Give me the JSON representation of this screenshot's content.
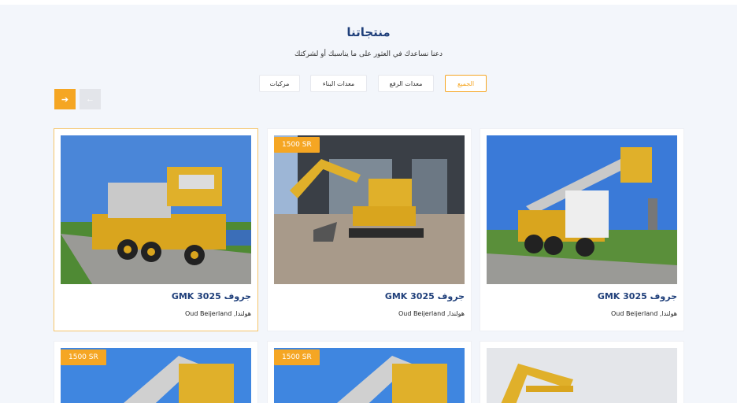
{
  "section": {
    "title": "منتجاتنا",
    "subtitle": "دعنا نساعدك في العثور على ما يناسبك أو لشركتك"
  },
  "filters": [
    {
      "label": "الجميع",
      "active": true
    },
    {
      "label": "معدات الرفع",
      "active": false
    },
    {
      "label": "معدات البناء",
      "active": false
    },
    {
      "label": "مركبات",
      "active": false
    }
  ],
  "nav": {
    "next": "➔",
    "prev": "←"
  },
  "products": [
    {
      "name": "جروف GMK 3025",
      "location": "هولندا, Oud Beijerland",
      "price": "",
      "image": "crane-truck-photo"
    },
    {
      "name": "جروف GMK 3025",
      "location": "هولندا, Oud Beijerland",
      "price": "1500 SR",
      "image": "excavator-photo"
    },
    {
      "name": "جروف GMK 3025",
      "location": "هولندا, Oud Beijerland",
      "price": "",
      "image": "grove-crane-photo"
    },
    {
      "name": "",
      "location": "",
      "price": "",
      "image": "sany-excavator-photo"
    },
    {
      "name": "",
      "location": "",
      "price": "1500 SR",
      "image": "crane-photo"
    },
    {
      "name": "",
      "location": "",
      "price": "1500 SR",
      "image": "crane-photo"
    }
  ],
  "colors": {
    "accent": "#f5a623",
    "title": "#1f3f7a",
    "background": "#f3f6fb"
  }
}
